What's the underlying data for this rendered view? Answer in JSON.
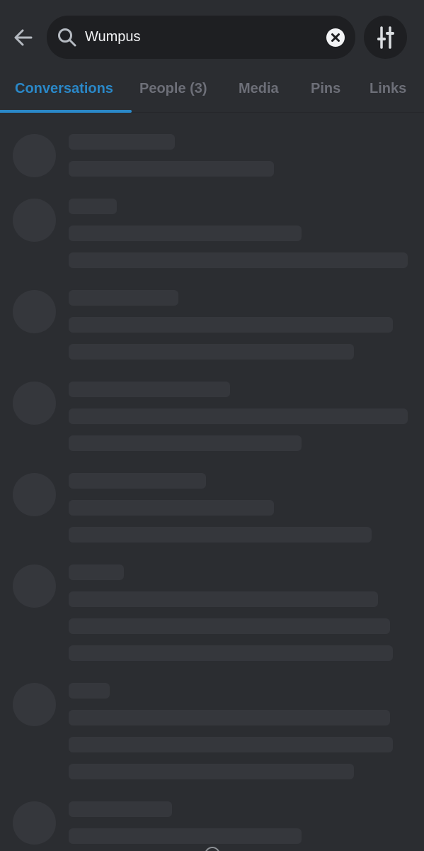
{
  "search": {
    "value": "Wumpus",
    "back_icon": "arrow-left-icon",
    "search_icon": "search-icon",
    "clear_icon": "close-circle-icon",
    "filter_icon": "sliders-icon"
  },
  "tabs": [
    {
      "label": "Conversations",
      "active": true
    },
    {
      "label": "People (3)",
      "active": false
    },
    {
      "label": "Media",
      "active": false
    },
    {
      "label": "Pins",
      "active": false
    },
    {
      "label": "Links",
      "active": false
    }
  ],
  "colors": {
    "background": "#2b2d31",
    "search_bg": "#1e1f22",
    "accent": "#2a88c8",
    "skeleton": "#35373c",
    "tab_inactive": "#6d6f78"
  },
  "loading": true
}
